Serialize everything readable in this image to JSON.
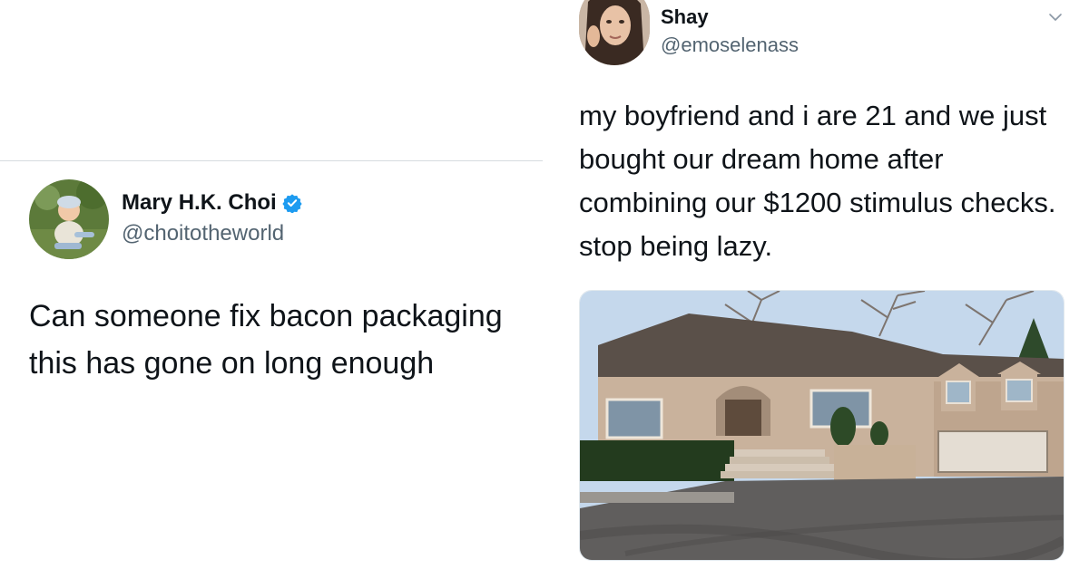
{
  "left_tweet": {
    "display_name": "Mary H.K. Choi",
    "handle": "@choitotheworld",
    "verified": true,
    "text": "Can someone fix bacon packaging this has gone on long enough"
  },
  "right_tweet": {
    "display_name": "Shay",
    "handle": "@emoselenass",
    "text": "my boyfriend and i are 21 and we just bought our dream home after combining our $1200 stimulus checks. stop being lazy.",
    "media_alt": "house-photo"
  },
  "colors": {
    "verified_blue": "#1d9bf0",
    "handle_gray": "#536471",
    "divider": "#d6dbdf"
  }
}
